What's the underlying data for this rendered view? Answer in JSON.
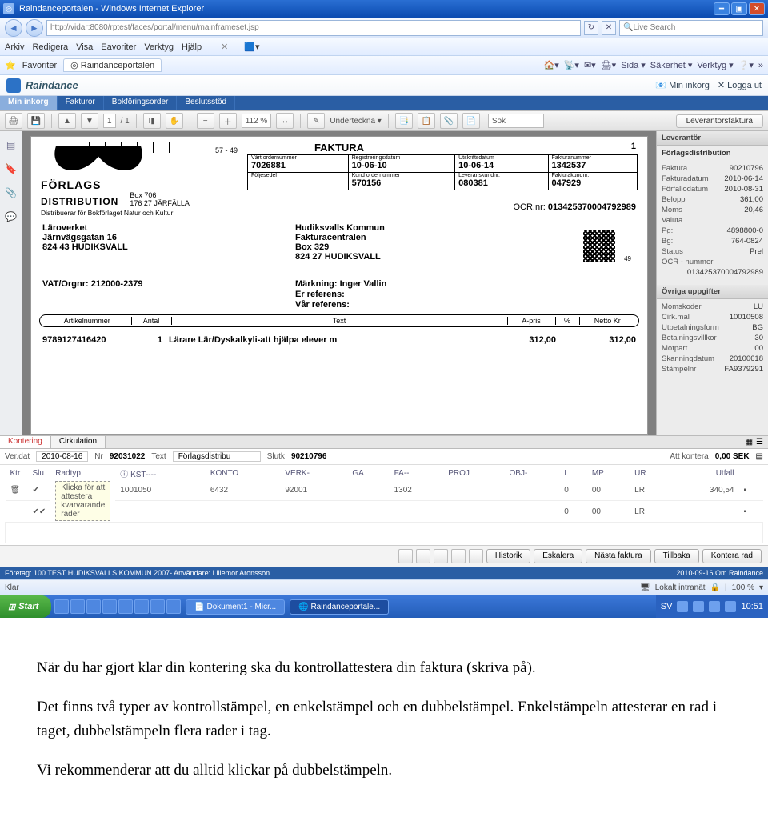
{
  "browser": {
    "title": "Raindanceportalen - Windows Internet Explorer",
    "url": "http://vidar:8080/rptest/faces/portal/menu/mainframeset.jsp",
    "search_placeholder": "Live Search",
    "menus": [
      "Arkiv",
      "Redigera",
      "Visa",
      "Eavoriter",
      "Verktyg",
      "Hjälp"
    ],
    "fav_label": "Favoriter",
    "tab_label": "Raindanceportalen",
    "toolbar_right": [
      "Sida ▾",
      "Säkerhet ▾",
      "Verktyg ▾"
    ]
  },
  "app": {
    "brand": "Raindance",
    "links": {
      "inbox": "Min inkorg",
      "logout": "Logga ut"
    },
    "tabs": [
      "Min inkorg",
      "Fakturor",
      "Bokföringsorder",
      "Beslutsstöd"
    ]
  },
  "pdfbar": {
    "page": "1",
    "pages": "/ 1",
    "zoom": "112 %",
    "sign": "Underteckna ▾",
    "search": "Sök",
    "invoice_type": "Leverantörsfaktura"
  },
  "invoice": {
    "pgno": "57 - 49",
    "title": "FAKTURA",
    "pagen": "1",
    "supplier": {
      "name1": "FÖRLAGS",
      "name2": "DISTRIBUTION",
      "box": "Box 706",
      "city": "176 27 JÄRFÄLLA",
      "desc": "Distribuerar för Bokförlaget Natur och Kultur"
    },
    "grid": {
      "h1": [
        "Vårt ordernummer",
        "Registreringsdatum",
        "Utskriftsdatum",
        "Fakturanummer"
      ],
      "v1": [
        "7026881",
        "10-06-10",
        "10-06-14",
        "1342537"
      ],
      "h2": [
        "Följesedel",
        "Kund ordernummer",
        "Leveranskundnr.",
        "Fakturakundnr."
      ],
      "v2": [
        "",
        "570156",
        "080381",
        "047929"
      ]
    },
    "ocr_label": "OCR.nr:",
    "ocr": "013425370004792989",
    "addr1": [
      "Läroverket",
      "Järnvägsgatan 16",
      "824 43 HUDIKSVALL"
    ],
    "addr2": [
      "Hudiksvalls Kommun",
      "Fakturacentralen",
      "Box 329",
      "824 27 HUDIKSVALL"
    ],
    "qrn": "49",
    "vat": "VAT/Orgnr: 212000-2379",
    "mk": [
      "Märkning: Inger Vallin",
      "Er referens:",
      "Vår referens:"
    ],
    "line_headers": [
      "Artikelnummer",
      "Antal",
      "Text",
      "A-pris",
      "%",
      "Netto Kr"
    ],
    "line": {
      "art": "9789127416420",
      "qty": "1",
      "text": "Lärare Lär/Dyskalkyli-att hjälpa elever m",
      "price": "312,00",
      "pct": "",
      "net": "312,00"
    }
  },
  "rpanel": {
    "hdr1": "Leverantör",
    "vendor": "Förlagsdistribution",
    "meta": [
      [
        "Faktura",
        "90210796"
      ],
      [
        "Fakturadatum",
        "2010-06-14"
      ],
      [
        "Förfallodatum",
        "2010-08-31"
      ],
      [
        "Belopp",
        "361,00"
      ],
      [
        "Moms",
        "20,46"
      ],
      [
        "Valuta",
        ""
      ],
      [
        "Pg:",
        "4898800-0"
      ],
      [
        "Bg:",
        "764-0824"
      ],
      [
        "Status",
        "Prel"
      ],
      [
        "OCR - nummer",
        ""
      ],
      [
        "",
        "013425370004792989"
      ]
    ],
    "hdr2": "Övriga uppgifter",
    "extra": [
      [
        "Momskoder",
        "LU"
      ],
      [
        "Cirk.mal",
        "10010508"
      ],
      [
        "Utbetalningsform",
        "BG"
      ],
      [
        "Betalningsvillkor",
        "30"
      ],
      [
        "Motpart",
        "00"
      ],
      [
        "Skanningdatum",
        "20100618"
      ],
      [
        "Stämpelnr",
        "FA9379291"
      ]
    ]
  },
  "kont": {
    "tabs": [
      "Kontering",
      "Cirkulation"
    ],
    "row1": {
      "verdat_l": "Ver.dat",
      "verdat": "2010-08-16",
      "nr_l": "Nr",
      "nr": "92031022",
      "text_l": "Text",
      "text": "Förlagsdistribu",
      "slutk_l": "Slutk",
      "slutk": "90210796",
      "attk_l": "Att kontera",
      "attk": "0,00 SEK"
    },
    "headers": [
      "Ktr",
      "Slu",
      "Radtyp",
      "KST----",
      "KONTO",
      "VERK-",
      "GA",
      "FA--",
      "PROJ",
      "OBJ-",
      "I",
      "MP",
      "UR",
      "Utfall"
    ],
    "tooltip": "Klicka för att attestera kvarvarande rader",
    "r1": {
      "kst": "1001050",
      "konto": "6432",
      "verk": "92001",
      "fa": "1302",
      "i": "0",
      "mp": "00",
      "ur": "LR",
      "utf": "340,54"
    },
    "r2": {
      "i": "0",
      "mp": "00",
      "ur": "LR"
    },
    "buttons": [
      "Historik",
      "Eskalera",
      "Nästa faktura",
      "Tillbaka",
      "Kontera rad"
    ]
  },
  "status": {
    "left": "Företag: 100 TEST HUDIKSVALLS KOMMUN 2007-   Användare: Lillemor Aronsson",
    "right": "2010-09-16  Om Raindance",
    "ie_left": "Klar",
    "ie_zone": "Lokalt intranät",
    "ie_zoom": "100 %"
  },
  "taskbar": {
    "start": "Start",
    "tasks": [
      "Dokument1 - Micr...",
      "Raindanceportale..."
    ],
    "time": "10:51"
  },
  "doc": {
    "p1": "När du har gjort klar din kontering ska du kontrollattestera din faktura (skriva på).",
    "p2": "Det finns två typer av kontrollstämpel, en enkelstämpel och en dubbelstämpel. Enkelstämpeln attesterar en rad i taget, dubbelstämpeln flera rader i tag.",
    "p3": "Vi rekommenderar att du alltid klickar på dubbelstämpeln."
  }
}
